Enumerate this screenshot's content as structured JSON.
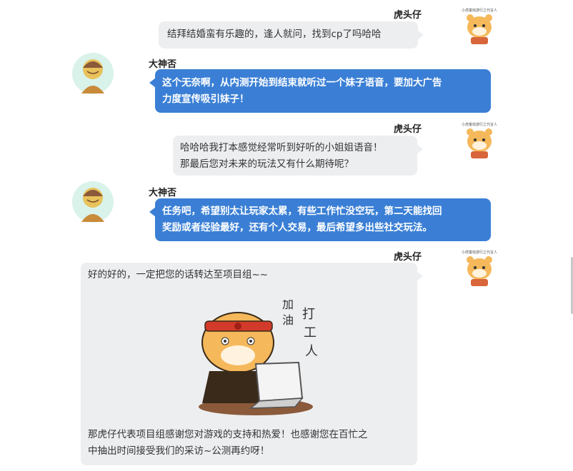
{
  "messages": [
    {
      "speaker": "虎头仔",
      "lines": [
        "结拜结婚蛮有乐趣的，逢人就问，找到cp了吗哈哈"
      ]
    },
    {
      "speaker": "大神否",
      "lines": [
        "这个无奈啊，从内测开始到结束就听过一个妹子语音，要加大广告",
        "力度宣传吸引妹子！"
      ]
    },
    {
      "speaker": "虎头仔",
      "lines": [
        "哈哈哈我打本感觉经常听到好听的小姐姐语音！",
        "那最后您对未来的玩法又有什么期待呢？"
      ]
    },
    {
      "speaker": "大神否",
      "lines": [
        "任务吧，希望别太让玩家太累，有些工作忙没空玩，第二天能找回",
        "奖励或者经验最好，还有个人交易，最后希望多出些社交玩法。"
      ]
    },
    {
      "speaker": "虎头仔",
      "lines": [
        "好的好的，一定把您的话转达至项目组~~"
      ],
      "lines_after": [
        "那虎仔代表项目组感谢您对游戏的支持和热爱！也感谢您在百忙之",
        "中抽出时间接受我们的采访~公测再约呀！"
      ]
    }
  ],
  "sticker": {
    "text_jia": "加",
    "text_you": "油",
    "text_da": "打",
    "text_gong": "工",
    "text_ren": "人"
  },
  "avatar_caption": "小虎童戏游行之代言人",
  "colors": {
    "blue": "#3a7fd5",
    "grey": "#edeef0"
  }
}
